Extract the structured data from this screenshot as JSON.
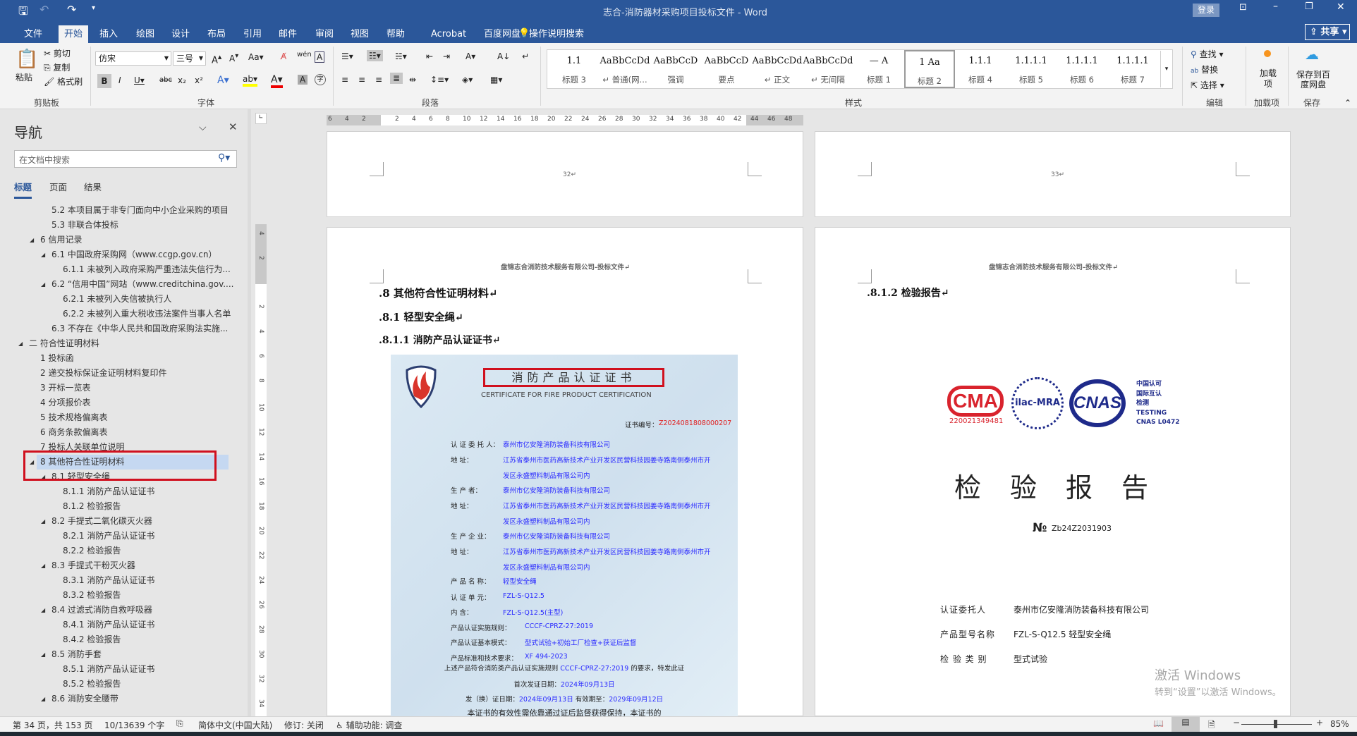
{
  "window": {
    "title": "志合-消防器材采购项目投标文件  -  Word",
    "login": "登录",
    "share": "共享",
    "accent": "#2b579a"
  },
  "tabs": [
    "文件",
    "开始",
    "插入",
    "绘图",
    "设计",
    "布局",
    "引用",
    "邮件",
    "审阅",
    "视图",
    "帮助",
    "Acrobat",
    "百度网盘"
  ],
  "tell_me": "操作说明搜索",
  "ribbon": {
    "clipboard": {
      "paste": "粘贴",
      "cut": "剪切",
      "copy": "复制",
      "format_painter": "格式刷",
      "label": "剪贴板"
    },
    "font": {
      "name": "仿宋",
      "size": "三号",
      "label": "字体",
      "highlight_color": "#ffff00",
      "font_color": "#e00000"
    },
    "paragraph": {
      "label": "段落"
    },
    "styles": {
      "label": "样式",
      "items": [
        {
          "preview": "1.1",
          "name": "标题 3"
        },
        {
          "preview": "AaBbCcDd",
          "name": "↵ 普通(网..."
        },
        {
          "preview": "AaBbCcD",
          "name": "强调"
        },
        {
          "preview": "AaBbCcD",
          "name": "要点"
        },
        {
          "preview": "AaBbCcDd",
          "name": "↵ 正文"
        },
        {
          "preview": "AaBbCcDd",
          "name": "↵ 无间隔"
        },
        {
          "preview": "—   A",
          "name": "标题 1"
        },
        {
          "preview": "1   Aa",
          "name": "标题 2"
        },
        {
          "preview": "1.1.1",
          "name": "标题 4"
        },
        {
          "preview": "1.1.1.1",
          "name": "标题 5"
        },
        {
          "preview": "1.1.1.1",
          "name": "标题 6"
        },
        {
          "preview": "1.1.1.1",
          "name": "标题 7"
        }
      ],
      "selected": "标题 2"
    },
    "editing": {
      "find": "查找",
      "replace": "替换",
      "select": "选择",
      "label": "编辑"
    },
    "addins": {
      "button": "加载项",
      "label": "加载项"
    },
    "save": {
      "button": "保存到百度网盘",
      "label": "保存"
    }
  },
  "nav": {
    "title": "导航",
    "search_placeholder": "在文档中搜索",
    "tabs": [
      "标题",
      "页面",
      "结果"
    ],
    "items": [
      {
        "text": "5.2 本项目属于非专门面向中小企业采购的项目",
        "level": 2,
        "arrow": false
      },
      {
        "text": "5.3 非联合体投标",
        "level": 2,
        "arrow": false
      },
      {
        "text": "6 信用记录",
        "level": 1,
        "arrow": true
      },
      {
        "text": "6.1 中国政府采购网（www.ccgp.gov.cn）",
        "level": 2,
        "arrow": true
      },
      {
        "text": "6.1.1 未被列入政府采购严重违法失信行为...",
        "level": 3,
        "arrow": false
      },
      {
        "text": "6.2 “信用中国”网站（www.creditchina.gov....",
        "level": 2,
        "arrow": true
      },
      {
        "text": "6.2.1 未被列入失信被执行人",
        "level": 3,
        "arrow": false
      },
      {
        "text": "6.2.2 未被列入重大税收违法案件当事人名单",
        "level": 3,
        "arrow": false
      },
      {
        "text": "6.3 不存在《中华人民共和国政府采购法实施...",
        "level": 2,
        "arrow": false
      },
      {
        "text": "二 符合性证明材料",
        "level": 0,
        "arrow": true
      },
      {
        "text": "1 投标函",
        "level": 1,
        "arrow": false
      },
      {
        "text": "2 递交投标保证金证明材料复印件",
        "level": 1,
        "arrow": false
      },
      {
        "text": "3 开标一览表",
        "level": 1,
        "arrow": false
      },
      {
        "text": "4 分项报价表",
        "level": 1,
        "arrow": false
      },
      {
        "text": "5 技术规格偏离表",
        "level": 1,
        "arrow": false
      },
      {
        "text": "6 商务条款偏离表",
        "level": 1,
        "arrow": false
      },
      {
        "text": "7 投标人关联单位说明",
        "level": 1,
        "arrow": false
      },
      {
        "text": "8 其他符合性证明材料",
        "level": 1,
        "arrow": true,
        "selected": true
      },
      {
        "text": "8.1 轻型安全绳",
        "level": 2,
        "arrow": true
      },
      {
        "text": "8.1.1 消防产品认证证书",
        "level": 3,
        "arrow": false
      },
      {
        "text": "8.1.2 检验报告",
        "level": 3,
        "arrow": false
      },
      {
        "text": "8.2 手提式二氧化碳灭火器",
        "level": 2,
        "arrow": true
      },
      {
        "text": "8.2.1 消防产品认证证书",
        "level": 3,
        "arrow": false
      },
      {
        "text": "8.2.2 检验报告",
        "level": 3,
        "arrow": false
      },
      {
        "text": "8.3 手提式干粉灭火器",
        "level": 2,
        "arrow": true
      },
      {
        "text": "8.3.1 消防产品认证证书",
        "level": 3,
        "arrow": false
      },
      {
        "text": "8.3.2 检验报告",
        "level": 3,
        "arrow": false
      },
      {
        "text": "8.4 过滤式消防自救呼吸器",
        "level": 2,
        "arrow": true
      },
      {
        "text": "8.4.1 消防产品认证证书",
        "level": 3,
        "arrow": false
      },
      {
        "text": "8.4.2 检验报告",
        "level": 3,
        "arrow": false
      },
      {
        "text": "8.5 消防手套",
        "level": 2,
        "arrow": true
      },
      {
        "text": "8.5.1 消防产品认证证书",
        "level": 3,
        "arrow": false
      },
      {
        "text": "8.5.2 检验报告",
        "level": 3,
        "arrow": false
      },
      {
        "text": "8.6 消防安全腰带",
        "level": 2,
        "arrow": true
      }
    ],
    "highlight_color": "#c5d8f1",
    "annotation_color": "#d0101e"
  },
  "ruler": {
    "h_left": [
      "6",
      "4",
      "2"
    ],
    "h_main": [
      "2",
      "4",
      "6",
      "8",
      "10",
      "12",
      "14",
      "16",
      "18",
      "20",
      "22",
      "24",
      "26",
      "28",
      "30",
      "32",
      "34",
      "36",
      "38",
      "40",
      "42"
    ],
    "h_right": [
      "44",
      "46",
      "48"
    ],
    "v_top": [
      "4",
      "2"
    ],
    "v_main": [
      "2",
      "4",
      "6",
      "8",
      "10",
      "12",
      "14",
      "16",
      "18",
      "20",
      "22",
      "24",
      "26",
      "28",
      "30",
      "32",
      "34"
    ]
  },
  "pages": {
    "p32_number": "32↵",
    "p33_number": "33↵",
    "header": "盘锦志合消防技术服务有限公司-投标文件↵",
    "left": {
      "h1": ".8  其他符合性证明材料↵",
      "h2": ".8.1   轻型安全绳↵",
      "h3": ".8.1.1 消防产品认证证书↵"
    },
    "right": {
      "h4": ".8.1.2 检验报告↵"
    }
  },
  "certificate": {
    "title": "消防产品认证证书",
    "subtitle": "CERTIFICATE FOR FIRE PRODUCT CERTIFICATION",
    "no_label": "证书编号：",
    "no": "Z2024081808000207",
    "rows": [
      {
        "label": "认 证 委 托 人：",
        "value": "泰州市亿安隆消防装备科技有限公司"
      },
      {
        "label": "地          址：",
        "value": "江苏省泰州市医药高新技术产业开发区民营科技园姜寺路南侧泰州市开"
      },
      {
        "label": "",
        "value": "发区永盛塑料制品有限公司内"
      },
      {
        "label": "生    产    者：",
        "value": "泰州市亿安隆消防装备科技有限公司"
      },
      {
        "label": "地          址：",
        "value": "江苏省泰州市医药高新技术产业开发区民营科技园姜寺路南侧泰州市开"
      },
      {
        "label": "",
        "value": "发区永盛塑料制品有限公司内"
      },
      {
        "label": "生 产 企 业：",
        "value": "泰州市亿安隆消防装备科技有限公司"
      },
      {
        "label": "地          址：",
        "value": "江苏省泰州市医药高新技术产业开发区民营科技园姜寺路南侧泰州市开"
      },
      {
        "label": "",
        "value": "发区永盛塑料制品有限公司内"
      },
      {
        "label": "产 品 名 称：",
        "value": "轻型安全绳"
      },
      {
        "label": "认 证 单 元：",
        "value": "FZL-S-Q12.5"
      },
      {
        "label": "内          含：",
        "value": "FZL-S-Q12.5(主型)"
      }
    ],
    "rows2": [
      {
        "label": "产品认证实施规则：",
        "value": "CCCF-CPRZ-27:2019"
      },
      {
        "label": "产品认证基本模式：",
        "value": "型式试验+初始工厂检查+获证后监督"
      },
      {
        "label": "产品标准和技术要求：",
        "value": "XF 494-2023"
      }
    ],
    "statement_a": "上述产品符合消防类产品认证实施规则 ",
    "statement_rule": "CCCF-CPRZ-27:2019",
    "statement_b": " 的要求，特发此证",
    "first_label": "首次发证日期：",
    "first_date": "2024年09月13日",
    "issue_label": "发（换）证日期：",
    "issue_date": "2024年09月13日",
    "valid_label": " 有效期至：",
    "valid_date": "2029年09月12日",
    "footer": "本证书的有效性需依靠通过证后监督获得保持，本证书的"
  },
  "report": {
    "cma_no": "220021349481",
    "cma": "CMA",
    "ilac": "ilac-MRA",
    "cnas": "CNAS",
    "cnas_text": [
      "中国认可",
      "国际互认",
      "检测",
      "TESTING",
      "CNAS L0472"
    ],
    "title": [
      "检",
      "验",
      "报",
      "告"
    ],
    "no_symbol": "№",
    "no": "Zb24Z2031903",
    "fields": [
      {
        "label": "认证委托人",
        "value": "泰州市亿安隆消防装备科技有限公司"
      },
      {
        "label": "产品型号名称",
        "value": "FZL-S-Q12.5 轻型安全绳"
      },
      {
        "label": "检 验 类 别",
        "value": "型式试验"
      }
    ]
  },
  "watermark": {
    "line1": "激活 Windows",
    "line2": "转到“设置”以激活 Windows。"
  },
  "status": {
    "page": "第 34 页，共 153 页",
    "words": "10/13639 个字",
    "language": "简体中文(中国大陆)",
    "track": "修订: 关闭",
    "accessibility": "辅助功能: 调查",
    "zoom": "85%",
    "zoom_percent": 85
  }
}
